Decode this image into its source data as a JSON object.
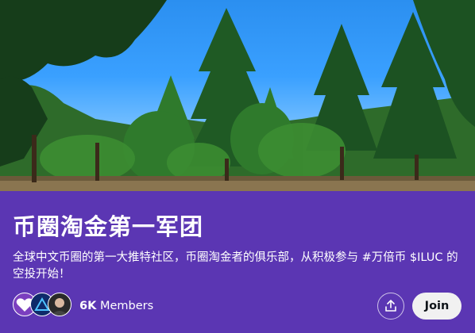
{
  "community": {
    "name": "币圈淘金第一军团",
    "description": "全球中文币圈的第一大推特社区，币圈淘金者的俱乐部，从积极参与 #万倍币 $ILUC 的空投开始！",
    "member_count": "6K",
    "member_label": "Members",
    "join_label": "Join",
    "avatar_1_text": "I love you baby"
  },
  "icons": {
    "share": "share-upload-icon"
  },
  "colors": {
    "panel_bg": "#5b36b3",
    "join_bg": "#f1f1f1",
    "text": "#ffffff"
  }
}
